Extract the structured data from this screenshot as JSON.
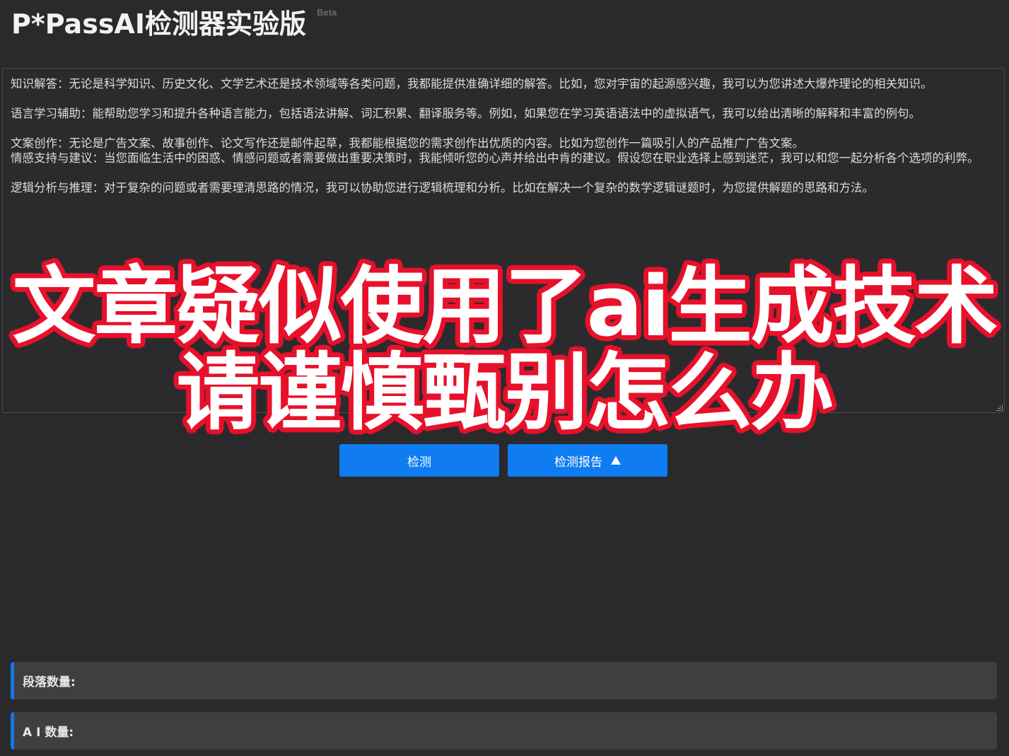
{
  "header": {
    "title": "P*PassAI检测器实验版",
    "badge": "Beta"
  },
  "input": {
    "paragraphs": [
      "知识解答：无论是科学知识、历史文化、文学艺术还是技术领域等各类问题，我都能提供准确详细的解答。比如，您对宇宙的起源感兴趣，我可以为您讲述大爆炸理论的相关知识。",
      "",
      "语言学习辅助：能帮助您学习和提升各种语言能力，包括语法讲解、词汇积累、翻译服务等。例如，如果您在学习英语语法中的虚拟语气，我可以给出清晰的解释和丰富的例句。",
      "",
      "文案创作：无论是广告文案、故事创作、论文写作还是邮件起草，我都能根据您的需求创作出优质的内容。比如为您创作一篇吸引人的产品推广广告文案。",
      "情感支持与建议：当您面临生活中的困惑、情感问题或者需要做出重要决策时，我能倾听您的心声并给出中肯的建议。假设您在职业选择上感到迷茫，我可以和您一起分析各个选项的利弊。",
      "",
      "逻辑分析与推理：对于复杂的问题或者需要理清思路的情况，我可以协助您进行逻辑梳理和分析。比如在解决一个复杂的数学逻辑谜题时，为您提供解题的思路和方法。"
    ]
  },
  "overlay": {
    "line1": "文章疑似使用了ai生成技术",
    "line2": "请谨慎甄别怎么办"
  },
  "actions": {
    "detect_label": "检测",
    "report_label": "检测报告"
  },
  "stats": {
    "paragraph_count_label": "段落数量:",
    "ai_count_label": "A I 数量:"
  },
  "colors": {
    "accent": "#0f7cf2",
    "overlay_outline": "#e8102a",
    "stat_border": "#1a73e8"
  }
}
